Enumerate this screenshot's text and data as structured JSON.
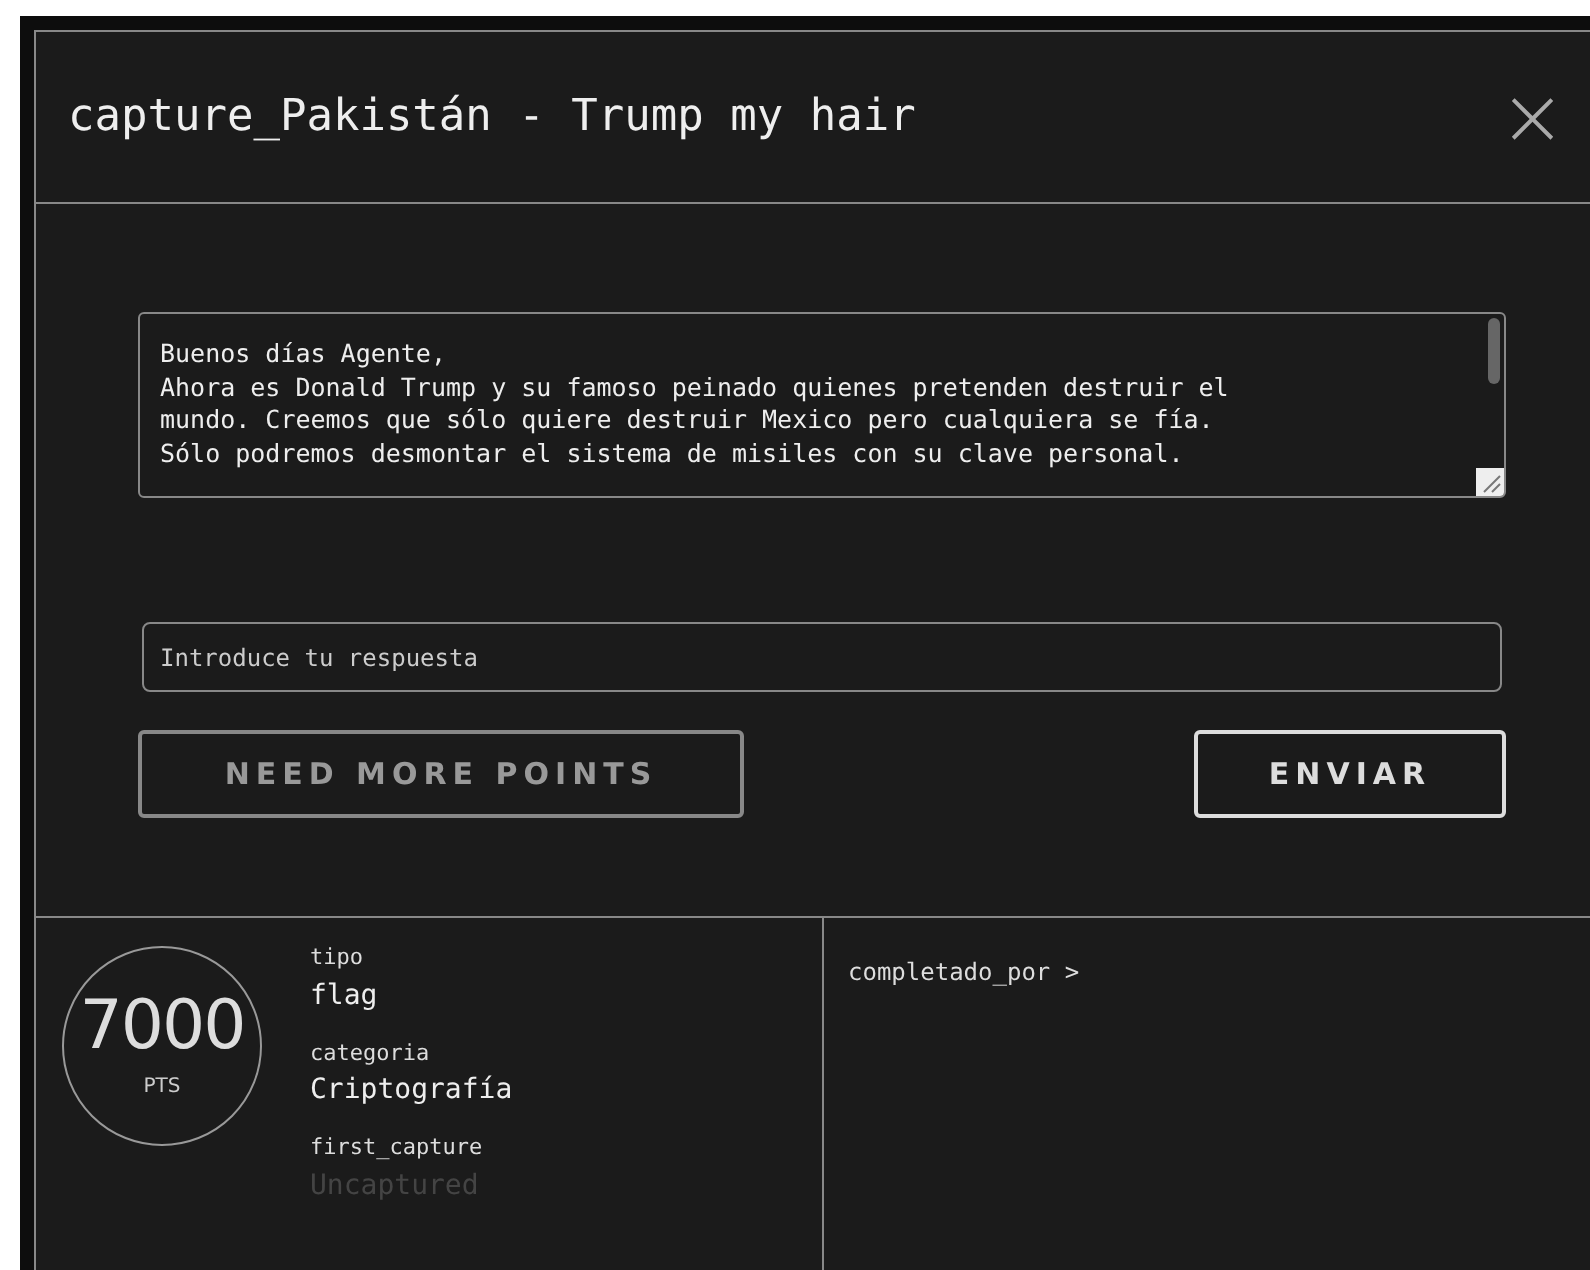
{
  "modal": {
    "title": "capture_Pakistán - Trump my hair",
    "close": "×"
  },
  "description": [
    "Buenos días Agente,",
    "Ahora es Donald Trump y su famoso peinado quienes pretenden destruir el",
    "mundo. Creemos que sólo quiere destruir Mexico pero cualquiera se fía.",
    "Sólo podremos desmontar el sistema de misiles con su clave personal."
  ],
  "answer": {
    "placeholder": "Introduce tu respuesta"
  },
  "buttons": [
    {
      "label": "NEED MORE POINTS",
      "disabled": true
    },
    {
      "label": "ENVIAR",
      "disabled": false
    }
  ],
  "points": {
    "value": "7000",
    "unit": "PTS"
  },
  "details": [
    {
      "label": "tipo",
      "value": "flag",
      "muted": false
    },
    {
      "label": "categoria",
      "value": "Criptografía",
      "muted": false
    },
    {
      "label": "first_capture",
      "value": "Uncaptured",
      "muted": true
    }
  ],
  "solvers": {
    "heading": "completado_por >"
  }
}
